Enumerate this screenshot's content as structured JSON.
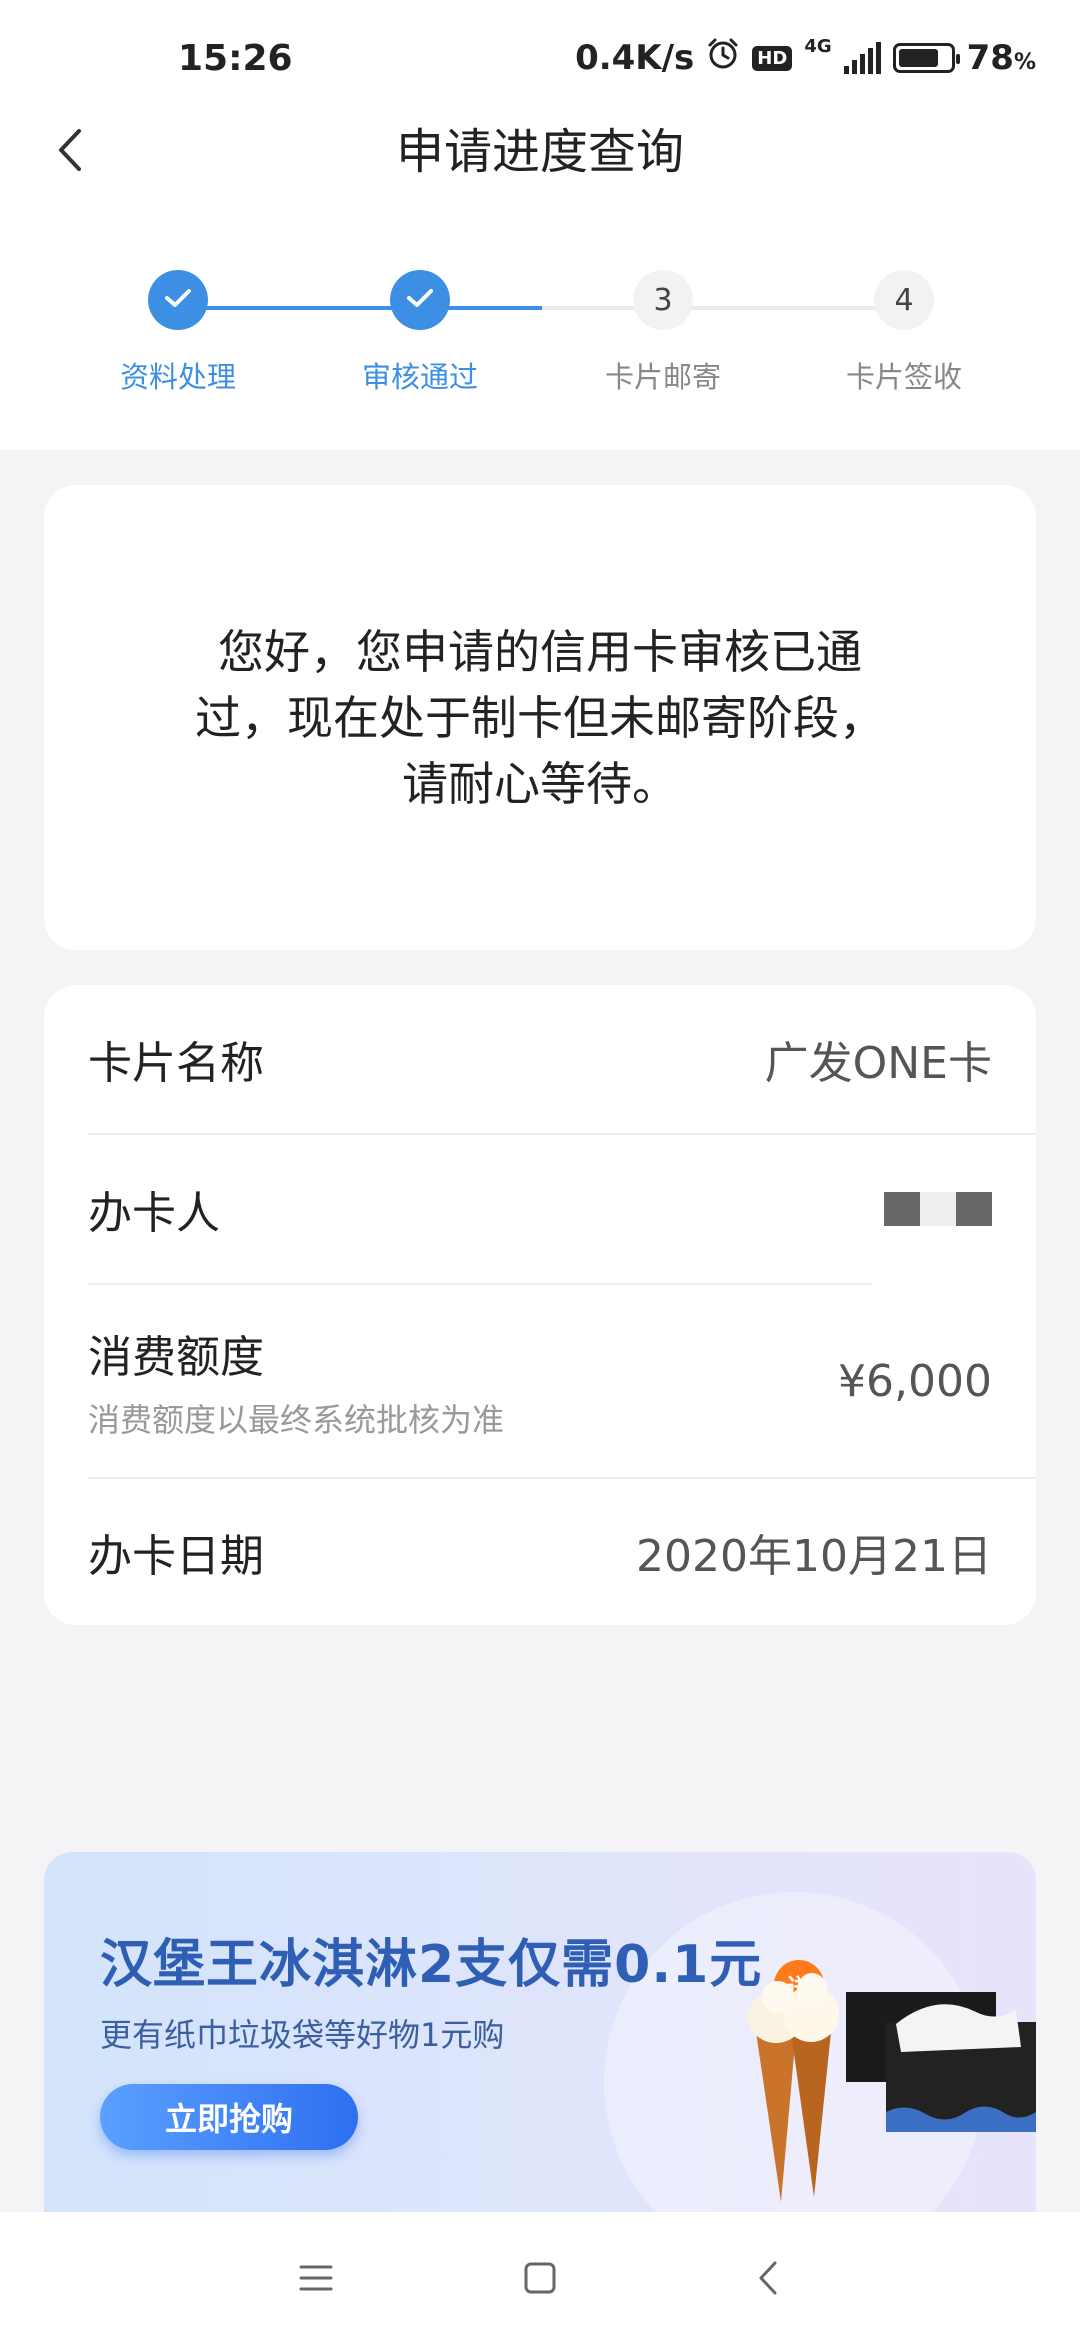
{
  "status_bar": {
    "time": "15:26",
    "net_speed": "0.4K/s",
    "hd": "HD",
    "network": "4G",
    "battery_pct": "78",
    "battery_unit": "%",
    "battery_level": 0.78
  },
  "header": {
    "title": "申请进度查询",
    "back_icon": "chevron-left-icon"
  },
  "steps": [
    {
      "label": "资料处理",
      "number": "1",
      "state": "done"
    },
    {
      "label": "审核通过",
      "number": "2",
      "state": "done"
    },
    {
      "label": "卡片邮寄",
      "number": "3",
      "state": "todo"
    },
    {
      "label": "卡片签收",
      "number": "4",
      "state": "todo"
    }
  ],
  "message": "您好，您申请的信用卡审核已通过，现在处于制卡但未邮寄阶段，请耐心等待。",
  "details": {
    "card_name": {
      "label": "卡片名称",
      "value": "广发ONE卡"
    },
    "holder": {
      "label": "办卡人"
    },
    "limit": {
      "label": "消费额度",
      "note": "消费额度以最终系统批核为准",
      "value": "¥6,000"
    },
    "date": {
      "label": "办卡日期",
      "value": "2020年10月21日"
    }
  },
  "banner": {
    "title": "汉堡王冰淇淋2支仅需0.1元",
    "subtitle": "更有纸巾垃圾袋等好物1元购",
    "button": "立即抢购",
    "badge": "送"
  },
  "colors": {
    "accent": "#3d8fe3",
    "banner_title": "#2f5fb5",
    "button": "#2f6ff0"
  }
}
